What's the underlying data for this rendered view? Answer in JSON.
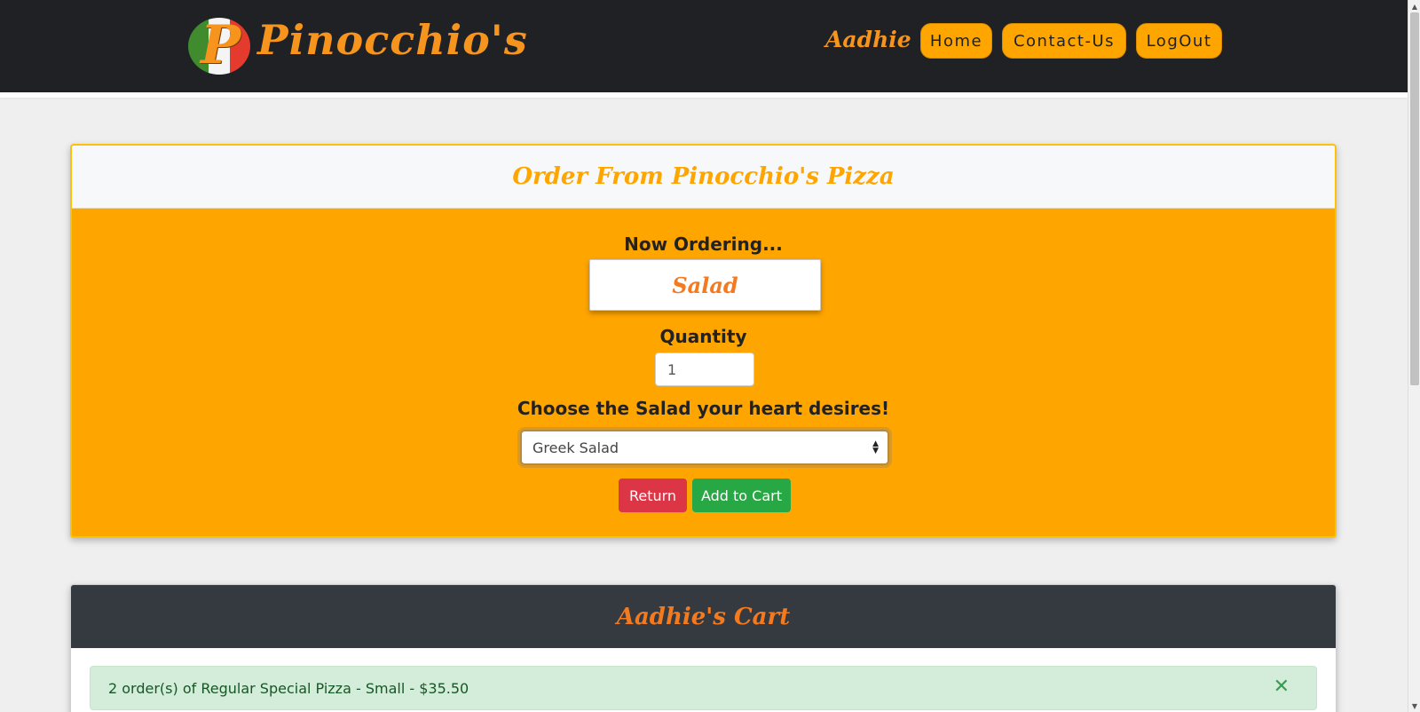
{
  "nav": {
    "brand": "Pinocchio's",
    "logo_letter": "P",
    "user": "Aadhie",
    "links": [
      "Home",
      "Contact-Us",
      "LogOut"
    ]
  },
  "order": {
    "title": "Order From Pinocchio's Pizza",
    "now_ordering_label": "Now Ordering...",
    "item": "Salad",
    "quantity_label": "Quantity",
    "quantity_value": "1",
    "choose_label": "Choose the Salad your heart desires!",
    "selected_option": "Greek Salad",
    "return_label": "Return",
    "add_label": "Add to Cart"
  },
  "cart": {
    "title": "Aadhie's Cart",
    "items": [
      {
        "text": "2 order(s) of Regular Special Pizza - Small - $35.50",
        "close": "✕"
      }
    ]
  },
  "colors": {
    "accent": "#ffa500",
    "brand_text": "#f7941d",
    "navbar": "#1f2125",
    "cart_header": "#343a40",
    "danger": "#dc3545",
    "success": "#28a745"
  }
}
